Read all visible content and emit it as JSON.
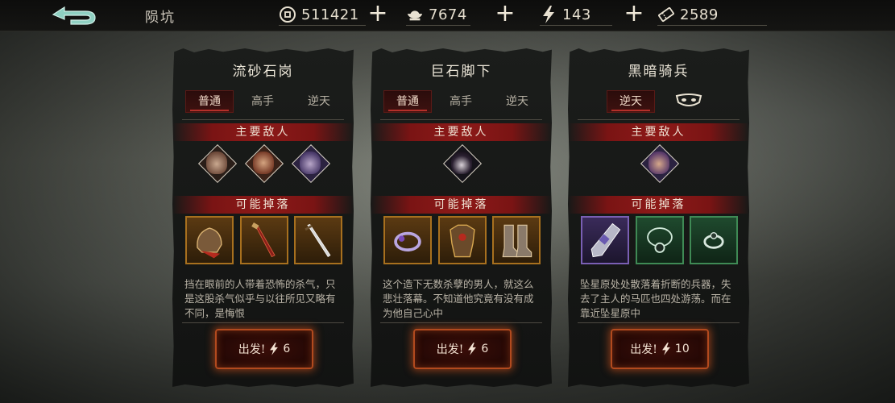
{
  "header": {
    "title": "陨坑",
    "resources": [
      {
        "name": "coins",
        "icon": "coin-icon",
        "value": "511421"
      },
      {
        "name": "ingots",
        "icon": "ingot-icon",
        "value": "7674"
      },
      {
        "name": "stamina",
        "icon": "lightning-icon",
        "value": "143"
      },
      {
        "name": "tickets",
        "icon": "ticket-icon",
        "value": "2589"
      }
    ]
  },
  "labels": {
    "main_enemies": "主要敌人",
    "possible_drops": "可能掉落"
  },
  "cards": [
    {
      "title": "流砂石岗",
      "tabs": [
        "普通",
        "高手",
        "逆天"
      ],
      "active_tab": 0,
      "enemies": [
        "masked-bandit",
        "scarred-brute",
        "hooded-monk"
      ],
      "drops": [
        {
          "item": "bronze-helmet",
          "rarity": "orange"
        },
        {
          "item": "crimson-blade",
          "rarity": "orange"
        },
        {
          "item": "steel-sword",
          "rarity": "orange"
        }
      ],
      "description": "挡在眼前的人带着恐怖的杀气，只是这股杀气似乎与以往所见又略有不同，是悔恨",
      "go_label": "出发!",
      "cost": "6"
    },
    {
      "title": "巨石脚下",
      "tabs": [
        "普通",
        "高手",
        "逆天"
      ],
      "active_tab": 0,
      "enemies": [
        "dark-swordsman"
      ],
      "drops": [
        {
          "item": "violet-ring",
          "rarity": "orange"
        },
        {
          "item": "gold-armor",
          "rarity": "orange"
        },
        {
          "item": "armored-boots",
          "rarity": "orange"
        }
      ],
      "description": "这个造下无数杀孽的男人，就这么悲壮落幕。不知道他究竟有没有成为他自己心中",
      "go_label": "出发!",
      "cost": "6"
    },
    {
      "title": "黑暗骑兵",
      "tabs": [
        "逆天"
      ],
      "active_tab": 0,
      "extra_tab_icon": "mask-icon",
      "enemies": [
        "hooded-monk"
      ],
      "drops": [
        {
          "item": "silver-gauntlet",
          "rarity": "purple"
        },
        {
          "item": "jade-necklace",
          "rarity": "green"
        },
        {
          "item": "jade-ring",
          "rarity": "green"
        }
      ],
      "description": "坠星原处处散落着折断的兵器，失去了主人的马匹也四处游荡。而在靠近坠星原中",
      "go_label": "出发!",
      "cost": "10"
    }
  ],
  "colors": {
    "accent_red": "#8d1a18",
    "drop_orange": "#a8701e",
    "drop_purple": "#7a5fb4",
    "drop_green": "#3f8a55",
    "button_glow": "#e65a1e"
  }
}
